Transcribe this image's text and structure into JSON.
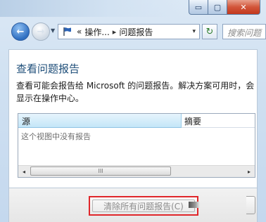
{
  "window": {
    "minimize_glyph": "▭",
    "maximize_glyph": "▢",
    "close_glyph": "✕"
  },
  "nav": {
    "back_glyph": "←",
    "forward_glyph": "→",
    "breadcrumb_prefix": "«",
    "breadcrumb_1": "操作...",
    "breadcrumb_sep": "▸",
    "breadcrumb_2": "问题报告",
    "address_dropdown_glyph": "▾",
    "refresh_glyph": "↻",
    "search_placeholder": "搜索问题"
  },
  "main": {
    "title": "查看问题报告",
    "description": "查看可能会报告给 Microsoft 的问题报告。解决方案可用时，会显示在操作中心。"
  },
  "table": {
    "columns": [
      "源",
      "摘要"
    ],
    "empty_message": "这个视图中没有报告",
    "scroll_left_glyph": "◂",
    "scroll_right_glyph": "▸",
    "scroll_thumb_grip": "III"
  },
  "footer": {
    "clear_button_label": "清除所有问题报告(C)"
  },
  "colors": {
    "accent": "#1e4e79",
    "selected_column": "#c4e6f8",
    "highlight_box": "#e0262a"
  }
}
